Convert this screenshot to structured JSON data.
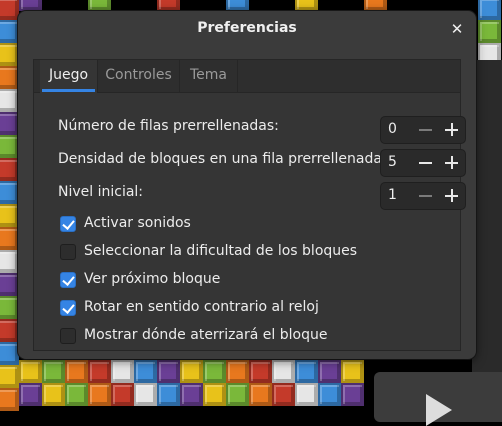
{
  "window": {
    "title": "Preferencias",
    "close_icon": "close-icon"
  },
  "tabs": [
    {
      "label": "Juego",
      "active": true
    },
    {
      "label": "Controles",
      "active": false
    },
    {
      "label": "Tema",
      "active": false
    }
  ],
  "settings": {
    "prefilled_rows": {
      "label": "Número de filas prerrellenadas:",
      "value": "0"
    },
    "prefilled_density": {
      "label": "Densidad de bloques en una fila prerrellenada:",
      "value": "5"
    },
    "start_level": {
      "label": "Nivel inicial:",
      "value": "1"
    }
  },
  "options": [
    {
      "label": "Activar sonidos",
      "checked": true
    },
    {
      "label": "Seleccionar la dificultad de los bloques",
      "checked": false
    },
    {
      "label": "Ver próximo bloque",
      "checked": true
    },
    {
      "label": "Rotar en sentido contrario al reloj",
      "checked": true
    },
    {
      "label": "Mostrar dónde aterrizará el bloque",
      "checked": false
    }
  ],
  "colors": {
    "accent": "#3584e4",
    "dialog_bg": "#3b3b3b",
    "block_colors": [
      "#e8c21a",
      "#c43a2a",
      "#6a3f95",
      "#e8781e",
      "#3d8dd8",
      "#7ab83a",
      "#e6e6e6"
    ]
  },
  "icons": {
    "minus": "minus-icon",
    "plus": "plus-icon",
    "check": "checkmark-icon",
    "play": "play-icon"
  }
}
